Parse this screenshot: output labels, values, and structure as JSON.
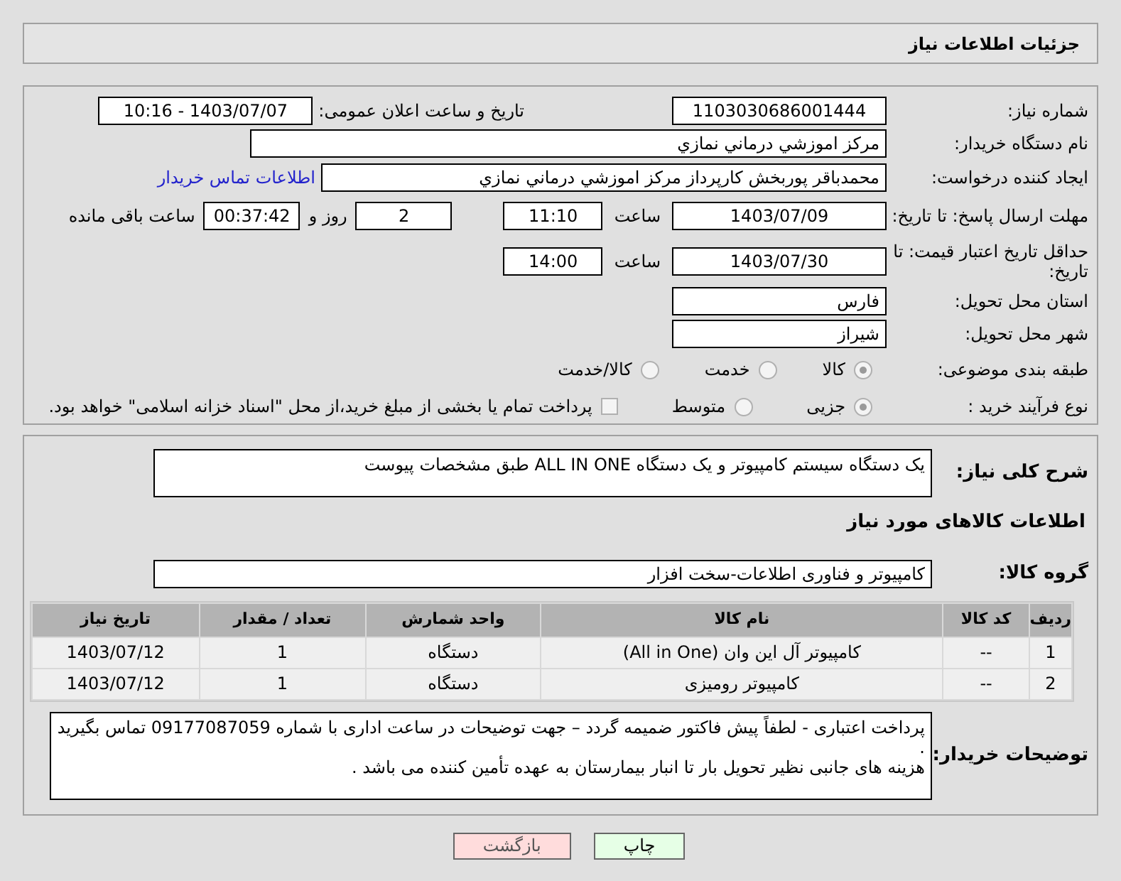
{
  "title": "جزئیات اطلاعات نیاز",
  "need_number": {
    "label": "شماره نیاز:",
    "value": "1103030686001444"
  },
  "announce": {
    "label": "تاریخ و ساعت اعلان عمومی:",
    "value": "1403/07/07 - 10:16"
  },
  "buyer_org": {
    "label": "نام دستگاه خریدار:",
    "value": "مرکز اموزشي درماني نمازي"
  },
  "requester": {
    "label": "ایجاد کننده درخواست:",
    "value": "محمدباقر پوربخش کارپرداز مرکز اموزشي درماني نمازي",
    "link": "اطلاعات تماس خریدار"
  },
  "reply_deadline": {
    "label": "مهلت ارسال پاسخ: تا تاریخ:",
    "date": "1403/07/09",
    "time_label": "ساعت",
    "time": "11:10",
    "days": "2",
    "days_label": "روز و",
    "remaining": "00:37:42",
    "remaining_label": "ساعت باقی مانده"
  },
  "price_validity": {
    "label": "حداقل تاریخ اعتبار قیمت: تا تاریخ:",
    "date": "1403/07/30",
    "time_label": "ساعت",
    "time": "14:00"
  },
  "province": {
    "label": "استان محل تحویل:",
    "value": "فارس"
  },
  "city": {
    "label": "شهر محل تحویل:",
    "value": "شیراز"
  },
  "category": {
    "label": "طبقه بندی موضوعی:",
    "options": [
      {
        "label": "کالا",
        "selected": true
      },
      {
        "label": "خدمت",
        "selected": false
      },
      {
        "label": "کالا/خدمت",
        "selected": false
      }
    ]
  },
  "process": {
    "label": "نوع فرآیند خرید :",
    "options": [
      {
        "label": "جزیی",
        "selected": true
      },
      {
        "label": "متوسط",
        "selected": false
      }
    ],
    "checkbox": {
      "label": "پرداخت تمام یا بخشی از مبلغ خرید،از محل \"اسناد خزانه اسلامی\" خواهد بود.",
      "checked": false
    }
  },
  "description": {
    "label": "شرح کلی نیاز:",
    "value": "یک دستگاه سیستم کامپیوتر و یک دستگاه ALL IN ONE طبق مشخصات پیوست"
  },
  "goods_title": "اطلاعات کالاهای مورد نیاز",
  "group": {
    "label": "گروه کالا:",
    "value": "کامپیوتر و فناوری اطلاعات-سخت افزار"
  },
  "table": {
    "columns": [
      "ردیف",
      "کد کالا",
      "نام کالا",
      "واحد شمارش",
      "تعداد / مقدار",
      "تاریخ نیاز"
    ],
    "rows": [
      [
        "1",
        "--",
        "کامپیوتر آل این وان (All in One)",
        "دستگاه",
        "1",
        "1403/07/12"
      ],
      [
        "2",
        "--",
        "کامپیوتر رومیزی",
        "دستگاه",
        "1",
        "1403/07/12"
      ]
    ]
  },
  "buyer_notes": {
    "label": "توضیحات خریدار:",
    "lines": [
      "پرداخت اعتباری - لطفاً پیش فاکتور ضمیمه گردد – جهت توضیحات در ساعت اداری با شماره  09177087059 تماس بگیرید .",
      "هزینه های جانبی نظیر تحویل بار تا انبار بیمارستان به عهده تأمین کننده می باشد ."
    ]
  },
  "buttons": [
    {
      "label": "چاپ",
      "kind": "print"
    },
    {
      "label": "بازگشت",
      "kind": "back"
    }
  ]
}
